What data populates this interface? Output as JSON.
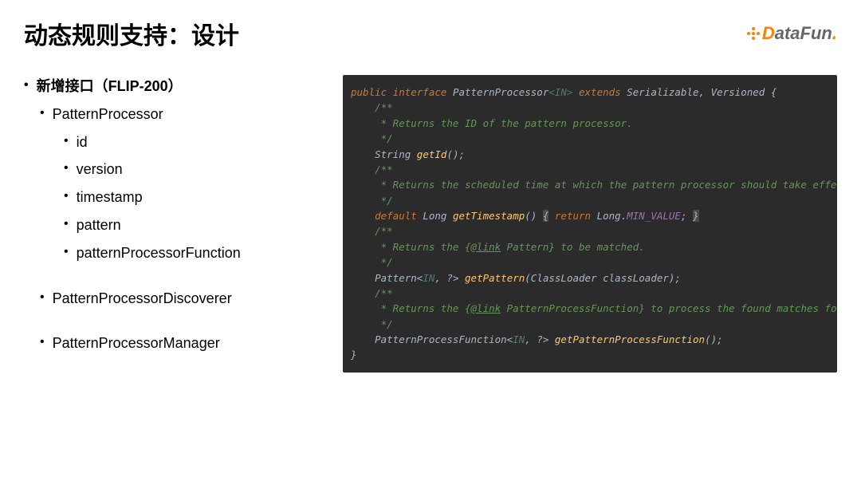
{
  "header": {
    "title": "动态规则支持：设计",
    "logo_text_d": "D",
    "logo_text_rest": "ataFun",
    "logo_period": "."
  },
  "bullets": {
    "item1": "新增接口（FLIP-200）",
    "item2": "PatternProcessor",
    "item2_1": "id",
    "item2_2": "version",
    "item2_3": "timestamp",
    "item2_4": "pattern",
    "item2_5": "patternProcessorFunction",
    "item3": "PatternProcessorDiscoverer",
    "item4": "PatternProcessorManager"
  },
  "code": {
    "l1_kw1": "public interface",
    "l1_name": " PatternProcessor",
    "l1_gen": "<IN>",
    "l1_kw2": " extends",
    "l1_rest": " Serializable, Versioned {",
    "blank": "",
    "c1_1": "    /**",
    "c1_2": "     * Returns the ID of the pattern processor.",
    "c1_3": "     */",
    "m1_type": "    String ",
    "m1_name": "getId",
    "m1_paren": "();",
    "c2_1": "    /**",
    "c2_2": "     * Returns the scheduled time at which the pattern processor should take effective.",
    "c2_3": "     */",
    "m2_kw": "    default",
    "m2_type": " Long ",
    "m2_name": "getTimestamp",
    "m2_p1": "() ",
    "m2_b1": "{",
    "m2_kw2": " return",
    "m2_cls": " Long.",
    "m2_field": "MIN_VALUE",
    "m2_end": "; ",
    "m2_b2": "}",
    "c3_1": "    /**",
    "c3_2a": "     * Returns the {",
    "c3_2b": "@link",
    "c3_2c": " Pattern",
    "c3_2d": "} to be matched.",
    "c3_3": "     */",
    "m3_a": "    Pattern<",
    "m3_b": "IN",
    "m3_c": ", ?> ",
    "m3_name": "getPattern",
    "m3_d": "(ClassLoader classLoader);",
    "c4_1": "    /**",
    "c4_2a": "     * Returns the {",
    "c4_2b": "@link",
    "c4_2c": " PatternProcessFunction",
    "c4_2d": "} to process the found matches for the pattern.",
    "c4_3": "     */",
    "m4_a": "    PatternProcessFunction<",
    "m4_b": "IN",
    "m4_c": ", ?> ",
    "m4_name": "getPatternProcessFunction",
    "m4_d": "();",
    "end": "}"
  }
}
